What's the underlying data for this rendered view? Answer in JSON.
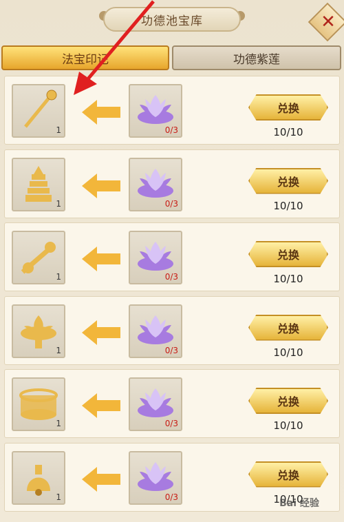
{
  "header": {
    "title": "功德池宝库"
  },
  "tabs": [
    {
      "label": "法宝印记"
    },
    {
      "label": "功德紫莲"
    }
  ],
  "rows": [
    {
      "item_icon": "staff-icon",
      "item_qty": "1",
      "cost_icon": "purple-lotus-icon",
      "cost_qty": "0/3",
      "button": "兑换",
      "count": "10/10"
    },
    {
      "item_icon": "pagoda-icon",
      "item_qty": "1",
      "cost_icon": "purple-lotus-icon",
      "cost_qty": "0/3",
      "button": "兑换",
      "count": "10/10"
    },
    {
      "item_icon": "gourd-sword-icon",
      "item_qty": "1",
      "cost_icon": "purple-lotus-icon",
      "cost_qty": "0/3",
      "button": "兑换",
      "count": "10/10"
    },
    {
      "item_icon": "lotus-throne-icon",
      "item_qty": "1",
      "cost_icon": "purple-lotus-icon",
      "cost_qty": "0/3",
      "button": "兑换",
      "count": "10/10"
    },
    {
      "item_icon": "drum-icon",
      "item_qty": "1",
      "cost_icon": "purple-lotus-icon",
      "cost_qty": "0/3",
      "button": "兑换",
      "count": "10/10"
    },
    {
      "item_icon": "bell-icon",
      "item_qty": "1",
      "cost_icon": "purple-lotus-icon",
      "cost_qty": "0/3",
      "button": "兑换",
      "count": "10/10"
    }
  ],
  "watermark": {
    "text": "Bai 经验"
  },
  "colors": {
    "accent": "#e7a52c",
    "cost_red": "#c81b14",
    "lotus": "#a77be0"
  }
}
